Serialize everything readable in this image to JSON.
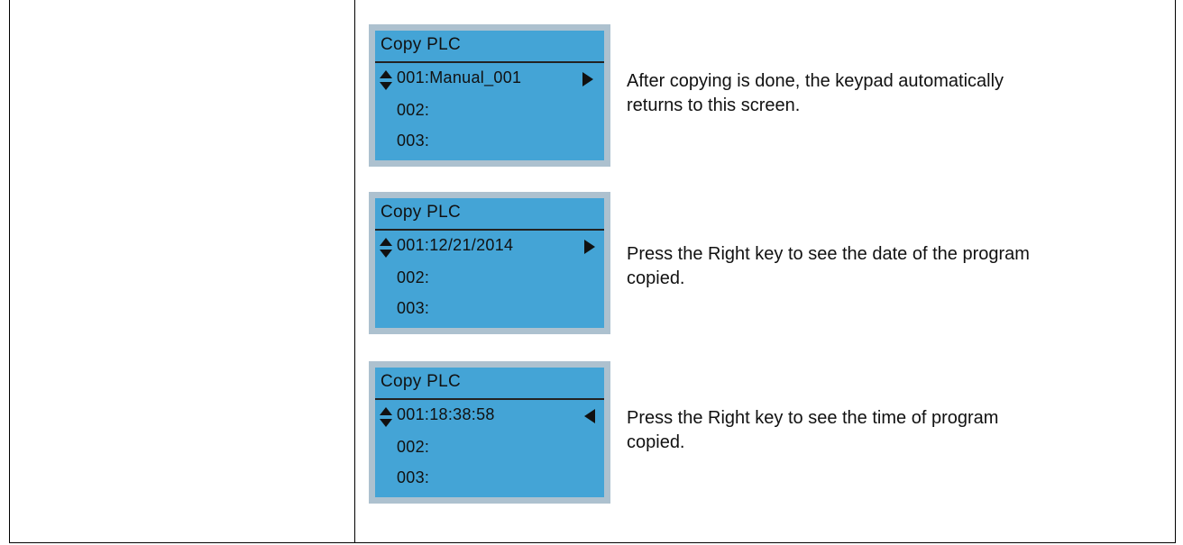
{
  "steps": [
    {
      "lcd_title": "Copy PLC",
      "row1": "001:Manual_001",
      "row2": "002:",
      "row3": "003:",
      "nav_arrow": "right-arrow-icon",
      "description_line1": "After copying is done, the keypad automatically",
      "description_line2": "returns to this screen."
    },
    {
      "lcd_title": "Copy PLC",
      "row1": "001:12/21/2014",
      "row2": "002:",
      "row3": "003:",
      "nav_arrow": "right-arrow-icon",
      "description_line1": "Press the Right key to see the date of the program",
      "description_line2": "copied."
    },
    {
      "lcd_title": "Copy PLC",
      "row1": "001:18:38:58",
      "row2": "002:",
      "row3": "003:",
      "nav_arrow": "left-arrow-icon",
      "description_line1": "Press the Right key to see the time of program",
      "description_line2": "copied."
    }
  ],
  "colors": {
    "lcd_background": "#44a4d6",
    "lcd_frame": "#adc1cf",
    "text": "#111111"
  }
}
